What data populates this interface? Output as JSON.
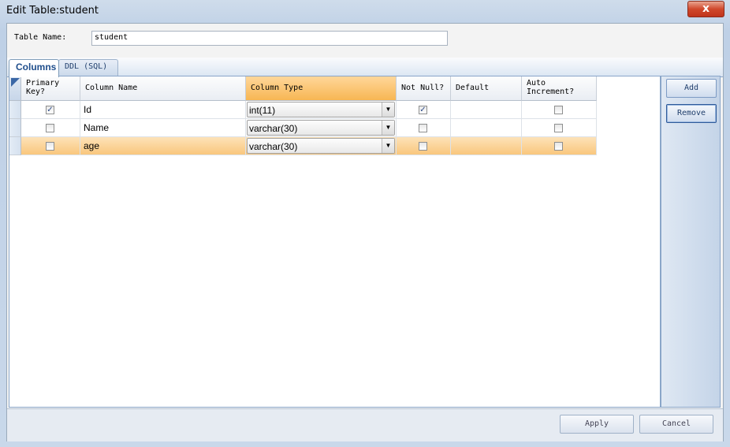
{
  "window": {
    "title": "Edit Table:student",
    "close_label": "x"
  },
  "table_name": {
    "label": "Table Name:",
    "value": "student"
  },
  "tabs": [
    {
      "label": "Columns"
    },
    {
      "label": "DDL (SQL)"
    }
  ],
  "columns": [
    {
      "label": "Primary\nKey?"
    },
    {
      "label": "Column Name"
    },
    {
      "label": "Column Type"
    },
    {
      "label": "Not Null?"
    },
    {
      "label": "Default"
    },
    {
      "label": "Auto\nIncrement?"
    }
  ],
  "rows": [
    {
      "primary_key": true,
      "name": "Id",
      "type": "int(11)",
      "not_null": true,
      "default": "",
      "auto_increment": false
    },
    {
      "primary_key": false,
      "name": "Name",
      "type": "varchar(30)",
      "not_null": false,
      "default": "",
      "auto_increment": false
    },
    {
      "primary_key": false,
      "name": "age",
      "type": "varchar(30)",
      "not_null": false,
      "default": "",
      "auto_increment": false
    }
  ],
  "side_buttons": {
    "add": "Add",
    "remove": "Remove"
  },
  "bottom_buttons": {
    "apply": "Apply",
    "cancel": "Cancel"
  },
  "colors": {
    "selected_row": "#f9c77d",
    "selected_header": "#f7b653",
    "accent": "#3a67a6"
  }
}
